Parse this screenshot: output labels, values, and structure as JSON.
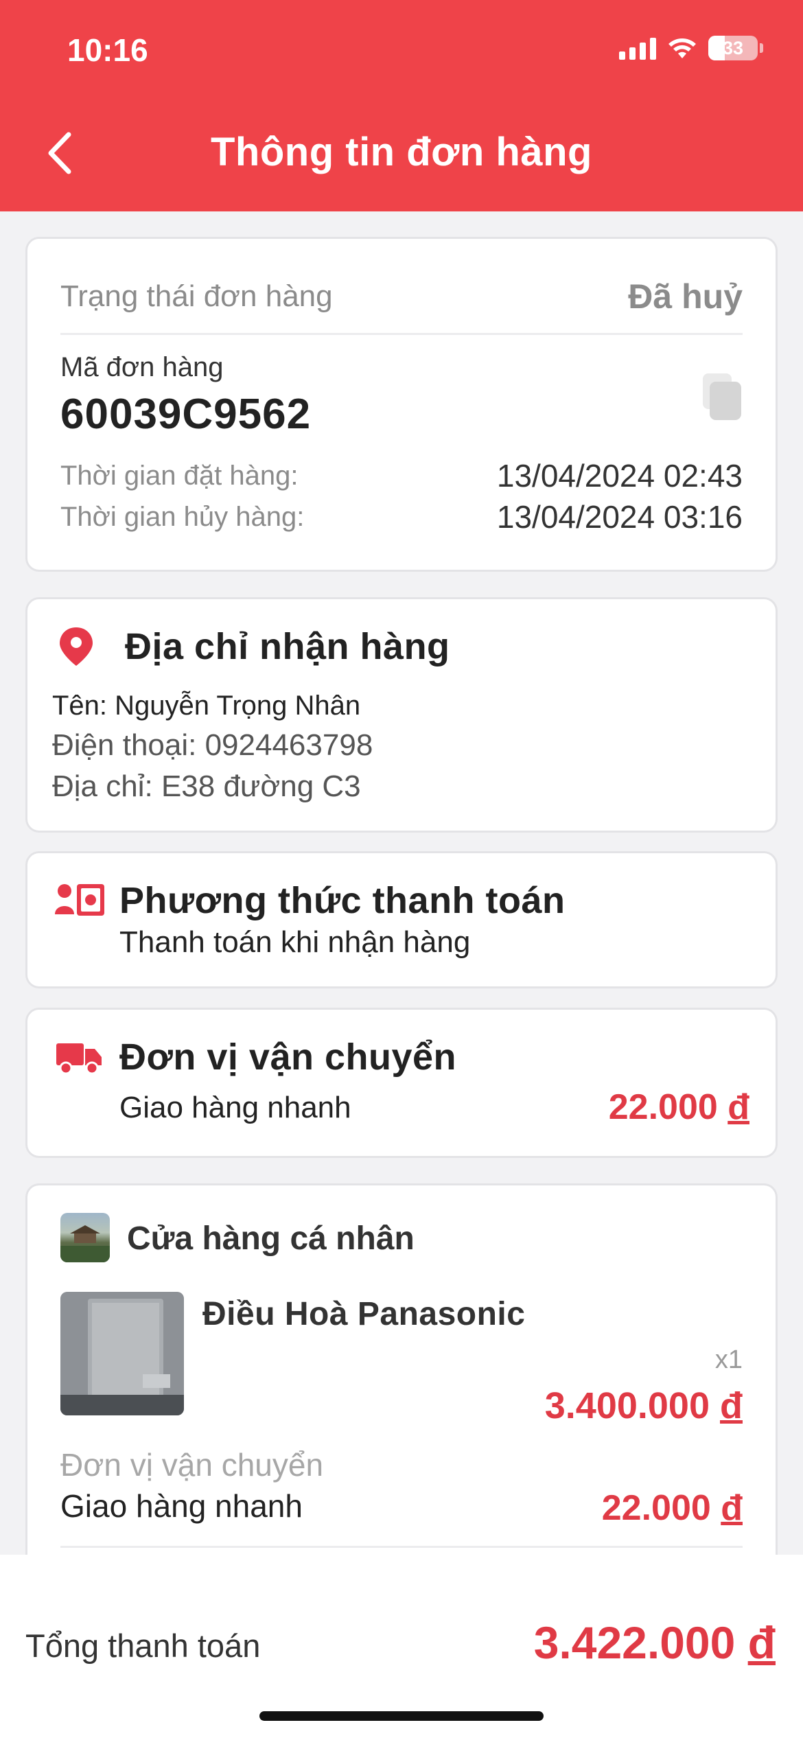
{
  "status_bar": {
    "time": "10:16",
    "battery": "33",
    "battery_fraction": 0.33
  },
  "header": {
    "title": "Thông tin đơn hàng"
  },
  "order": {
    "status_label": "Trạng thái đơn hàng",
    "status_value": "Đã huỷ",
    "code_label": "Mã đơn hàng",
    "code": "60039C9562",
    "placed_label": "Thời gian đặt hàng:",
    "placed_value": "13/04/2024 02:43",
    "cancelled_label": "Thời gian hủy hàng:",
    "cancelled_value": "13/04/2024 03:16"
  },
  "address": {
    "title": "Địa chỉ nhận hàng",
    "name": "Tên: Nguyễn Trọng Nhân",
    "phone": "Điện thoại: 0924463798",
    "address": "Địa chỉ: E38 đường C3"
  },
  "payment": {
    "title": "Phương thức thanh toán",
    "method": "Thanh toán khi nhận hàng"
  },
  "shipping": {
    "title": "Đơn vị vận chuyển",
    "carrier": "Giao hàng nhanh",
    "fee": "22.000",
    "currency": "đ"
  },
  "shop": {
    "name": "Cửa hàng cá nhân",
    "product_name": "Điều Hoà Panasonic",
    "quantity": "x1",
    "product_price": "3.400.000",
    "currency": "đ",
    "shipping_label": "Đơn vị vận chuyển",
    "shipping_carrier": "Giao hàng nhanh",
    "shipping_fee": "22.000"
  },
  "total": {
    "label": "Tổng thanh toán",
    "value": "3.422.000",
    "currency": "đ"
  },
  "colors": {
    "brand": "#ef4349",
    "price": "#e03a45",
    "muted": "#8b8b8b"
  }
}
